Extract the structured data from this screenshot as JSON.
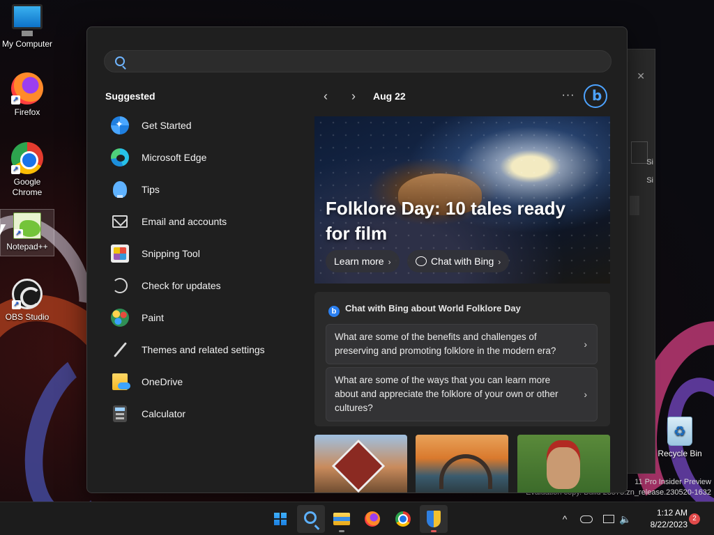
{
  "desktop": {
    "icons": [
      {
        "label": "My Computer",
        "icon": "computer-icon"
      },
      {
        "label": "Firefox",
        "icon": "firefox-icon"
      },
      {
        "label": "Google Chrome",
        "icon": "chrome-icon"
      },
      {
        "label": "Notepad++",
        "icon": "notepad-plus-plus-icon"
      },
      {
        "label": "OBS Studio",
        "icon": "obs-studio-icon"
      },
      {
        "label": "Recycle Bin",
        "icon": "recycle-bin-icon"
      }
    ],
    "watermark": {
      "line1": "11 Pro Insider Preview",
      "line2": "Evaluation copy. Build 23575.zn_release.230520-1632"
    },
    "background_window": {
      "fragment1": "Si",
      "fragment2": "Si"
    }
  },
  "search": {
    "placeholder": "",
    "value": "",
    "icon": "search-icon",
    "accent": "#6fb5ff"
  },
  "suggested": {
    "title": "Suggested",
    "items": [
      {
        "label": "Get Started",
        "icon": "get-started-icon"
      },
      {
        "label": "Microsoft Edge",
        "icon": "edge-icon"
      },
      {
        "label": "Tips",
        "icon": "tips-icon"
      },
      {
        "label": "Email and accounts",
        "icon": "mail-icon"
      },
      {
        "label": "Snipping Tool",
        "icon": "snipping-tool-icon"
      },
      {
        "label": "Check for updates",
        "icon": "refresh-icon"
      },
      {
        "label": "Paint",
        "icon": "paint-icon"
      },
      {
        "label": "Themes and related settings",
        "icon": "brush-icon"
      },
      {
        "label": "OneDrive",
        "icon": "onedrive-icon"
      },
      {
        "label": "Calculator",
        "icon": "calculator-icon"
      }
    ]
  },
  "highlights": {
    "date": "Aug 22",
    "prev_icon": "chevron-left-icon",
    "next_icon": "chevron-right-icon",
    "more_label": "···",
    "bing_icon": "bing-icon",
    "hero": {
      "title": "Folklore Day: 10 tales ready for film",
      "learn_more": "Learn more",
      "chat_with_bing": "Chat with Bing"
    },
    "bing_card": {
      "heading": "Chat with Bing about World Folklore Day",
      "questions": [
        "What are some of the benefits and challenges of preserving and promoting folklore in the modern era?",
        "What are some of the ways that you can learn more about and appreciate the folklore of your own or other cultures?"
      ]
    }
  },
  "taskbar": {
    "apps": [
      {
        "name": "start",
        "icon": "windows-logo-icon"
      },
      {
        "name": "search",
        "icon": "search-icon"
      },
      {
        "name": "file-explorer",
        "icon": "folder-icon"
      },
      {
        "name": "firefox",
        "icon": "firefox-icon"
      },
      {
        "name": "chrome",
        "icon": "chrome-icon"
      },
      {
        "name": "security",
        "icon": "shield-icon"
      }
    ],
    "time": "1:12 AM",
    "date": "8/22/2023",
    "notifications": "2",
    "tray_chevron": "^"
  },
  "colors": {
    "panel_bg": "#1f1f1f",
    "accent": "#4da3ff",
    "notification": "#e04a4a"
  }
}
